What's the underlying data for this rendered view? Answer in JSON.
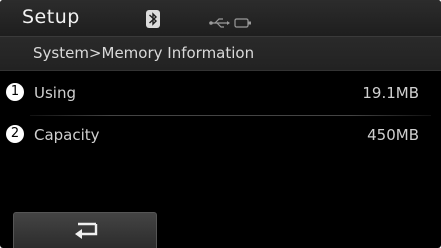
{
  "header": {
    "title": "Setup",
    "icons": [
      "bluetooth-icon",
      "usb-icon",
      "battery-icon"
    ]
  },
  "breadcrumb": {
    "text": "System>Memory Information"
  },
  "rows": [
    {
      "callout": "1",
      "label": "Using",
      "value": "19.1MB"
    },
    {
      "callout": "2",
      "label": "Capacity",
      "value": "450MB"
    }
  ],
  "footer": {
    "back_icon": "return-arrow-icon"
  },
  "colors": {
    "screen_bg": "#000000",
    "bar_bg": "#242424",
    "text": "#d0d0d0"
  }
}
